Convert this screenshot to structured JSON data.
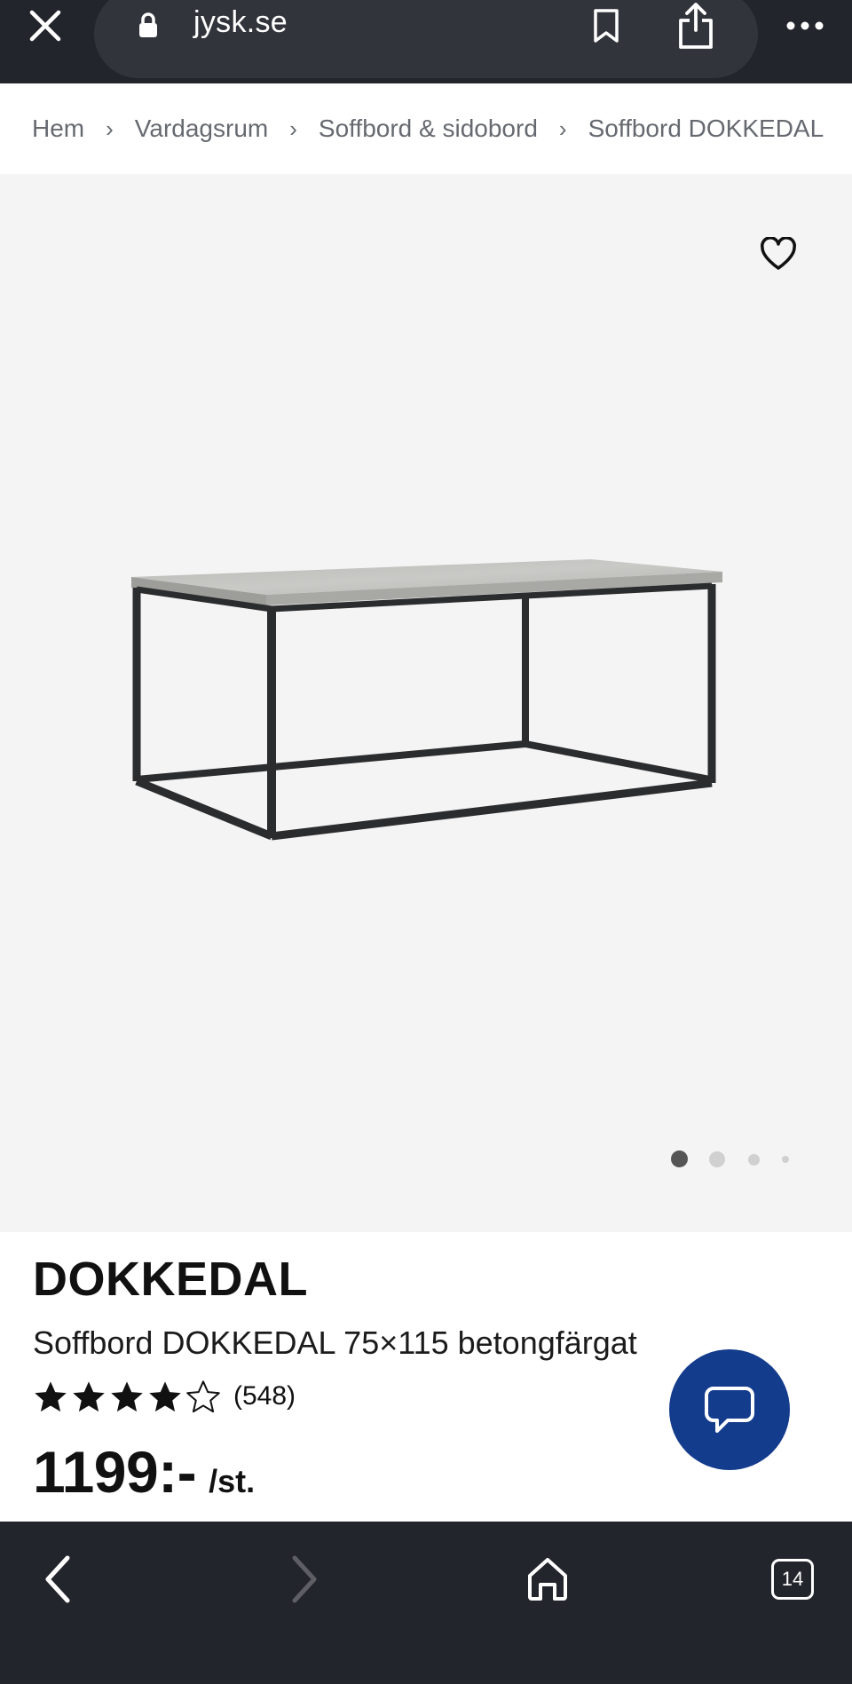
{
  "browser": {
    "url": "jysk.se",
    "tab_count": "14"
  },
  "breadcrumb": [
    {
      "label": "Hem"
    },
    {
      "label": "Vardagsrum"
    },
    {
      "label": "Soffbord & sidobord"
    },
    {
      "label": "Soffbord DOKKEDAL"
    }
  ],
  "gallery": {
    "image_count": 4,
    "active_index": 0
  },
  "product": {
    "brand": "DOKKEDAL",
    "subtitle": "Soffbord DOKKEDAL 75×115 betongfärgat",
    "rating": 4,
    "rating_max": 5,
    "review_count": "(548)",
    "price": "1199:-",
    "unit": "/st."
  },
  "icons": {
    "close": "close-icon",
    "lock": "lock-icon",
    "bookmark": "bookmark-icon",
    "share": "share-icon",
    "more": "more-icon",
    "favorite": "heart-icon",
    "chat": "chat-icon",
    "back": "chevron-left-icon",
    "forward": "chevron-right-icon",
    "home": "home-icon",
    "tabs": "tabs-icon"
  },
  "colors": {
    "chrome": "#23252c",
    "gallery_bg": "#f4f4f4",
    "chat_button": "#143c8c",
    "text_muted": "#666a70"
  }
}
